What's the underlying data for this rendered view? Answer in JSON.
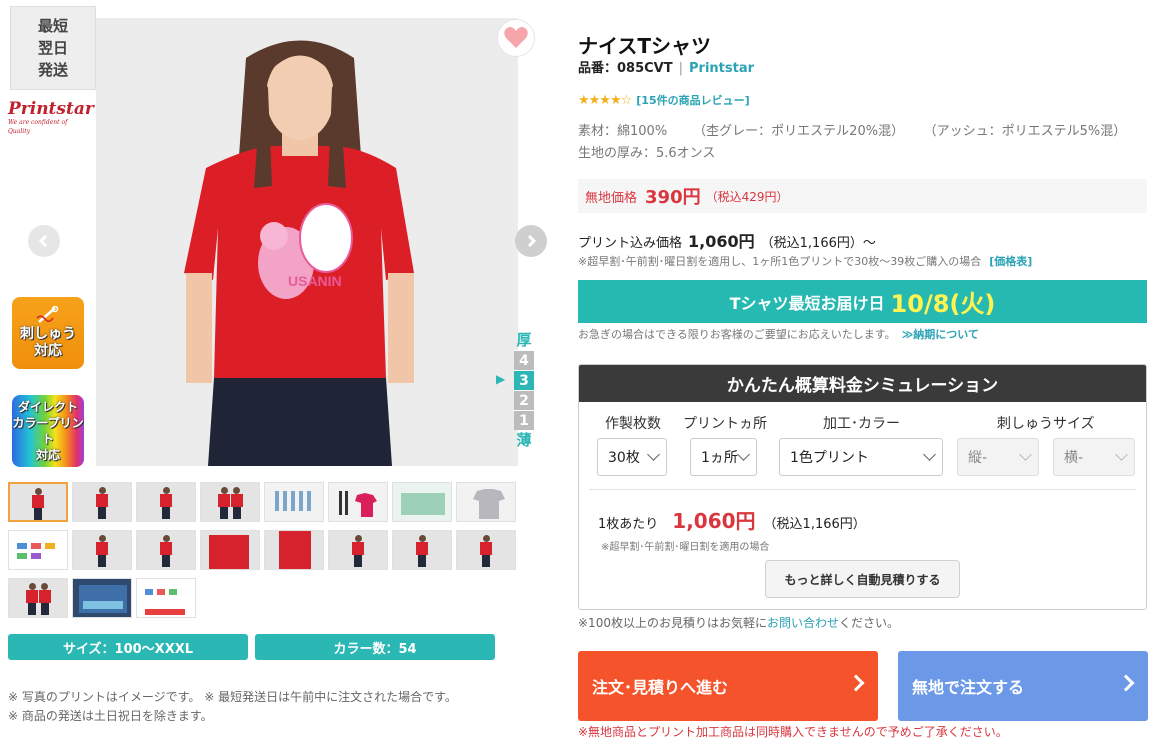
{
  "badges": {
    "fastest_lines": [
      "最短",
      "翌日",
      "発送"
    ],
    "brand_logo_text": "Printstar",
    "brand_logo_tagline": "We are confident of Quality",
    "embroidery_lines": [
      "刺しゅう",
      "対応"
    ],
    "direct_print_lines": [
      "ダイレクト",
      "カラープリント",
      "対応"
    ]
  },
  "gallery": {
    "shirt_print_text": "USANIN",
    "thickness": {
      "thick_label": "厚",
      "thin_label": "薄",
      "levels": [
        "4",
        "3",
        "2",
        "1"
      ],
      "current": "3",
      "pointer": "▶"
    },
    "thumbnail_count": 19
  },
  "info_pills": {
    "size": "サイズ：100〜XXXL",
    "colors": "カラー数：54"
  },
  "left_notes": [
    "※ 写真のプリントはイメージです。 ※ 最短発送日は午前中に注文された場合です。",
    "※ 商品の発送は土日祝日を除きます。"
  ],
  "product": {
    "title": "ナイスTシャツ",
    "item_no": "品番：085CVT",
    "separator": "|",
    "brand": "Printstar",
    "rating": 4.5,
    "stars": "★★★★☆",
    "review_link": "[15件の商品レビュー]",
    "material_base": "素材：綿100%",
    "material_gray": "（杢グレー：ポリエステル20%混）",
    "material_ash": "（アッシュ：ポリエステル5%混）",
    "thickness_text": "生地の厚み：5.6オンス"
  },
  "pricing": {
    "plain_label": "無地価格",
    "plain_price": "390円",
    "plain_tax": "（税込429円）",
    "print_label": "プリント込み価格",
    "print_price": "1,060円",
    "print_tax": "（税込1,166円）〜",
    "print_note": "※超早割･午前割･曜日割を適用し、1ヶ所1色プリントで30枚〜39枚ご購入の場合",
    "price_table_link": "[価格表]"
  },
  "delivery": {
    "label": "Tシャツ最短お届け日",
    "date": "10/8(火)",
    "note": "お急ぎの場合はできる限りお客様のご要望にお応えいたします。",
    "link": "≫納期について"
  },
  "simulator": {
    "title": "かんたん概算料金シミュレーション",
    "labels": {
      "quantity": "作製枚数",
      "locations": "プリントヵ所",
      "process": "加工･カラー",
      "embroidery_size": "刺しゅうサイズ"
    },
    "selects": {
      "quantity": "30枚",
      "locations": "1ヵ所",
      "process": "1色プリント",
      "height": "縦-",
      "width": "横-"
    },
    "per_unit_label": "1枚あたり",
    "per_unit_price": "1,060円",
    "per_unit_tax": "（税込1,166円）",
    "note": "※超早割･午前割･曜日割を適用の場合",
    "detail_button": "もっと詳しく自動見積りする"
  },
  "bulk_note_prefix": "※100枚以上のお見積りはお気軽に",
  "bulk_note_link": "お問い合わせ",
  "bulk_note_suffix": "ください。",
  "cta": {
    "order": "注文･見積りへ進む",
    "plain_order": "無地で注文する"
  },
  "bottom_note": "※無地商品とプリント加工商品は同時購入できませんので予めご了承ください。",
  "colors": {
    "teal": "#26b9b1",
    "price_red": "#d9363e",
    "order_orange": "#f5532b",
    "plain_blue": "#6c98e8",
    "link_teal": "#2ba3b5"
  }
}
